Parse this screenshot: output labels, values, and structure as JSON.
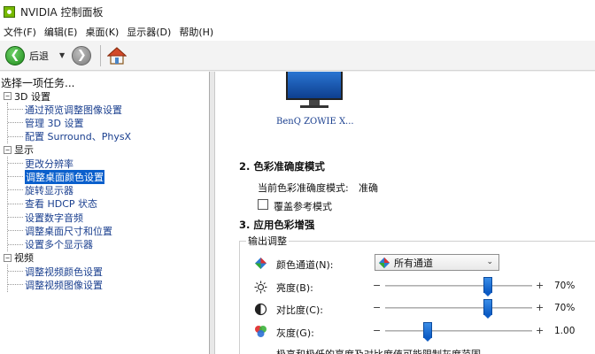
{
  "window": {
    "title": "NVIDIA 控制面板"
  },
  "menu": [
    "文件(F)",
    "编辑(E)",
    "桌面(K)",
    "显示器(D)",
    "帮助(H)"
  ],
  "toolbar": {
    "back_label": "后退"
  },
  "task_pane": {
    "header": "选择一项任务...",
    "categories": [
      {
        "label": "3D 设置",
        "toggle": "−",
        "items": [
          "通过预览调整图像设置",
          "管理 3D 设置",
          "配置 Surround、PhysX"
        ]
      },
      {
        "label": "显示",
        "toggle": "−",
        "items": [
          "更改分辨率",
          "调整桌面颜色设置",
          "旋转显示器",
          "查看 HDCP 状态",
          "设置数字音频",
          "调整桌面尺寸和位置",
          "设置多个显示器"
        ]
      },
      {
        "label": "视频",
        "toggle": "−",
        "items": [
          "调整视频颜色设置",
          "调整视频图像设置"
        ]
      }
    ],
    "selected_item": "调整桌面颜色设置"
  },
  "content": {
    "monitor_label": "BenQ ZOWIE X...",
    "section2": {
      "title": "2. 色彩准确度模式",
      "current_mode_label": "当前色彩准确度模式:",
      "current_mode_value": "准确",
      "override_label": "覆盖参考模式"
    },
    "section3": {
      "title": "3. 应用色彩增强",
      "group_title": "输出调整",
      "channel": {
        "label": "颜色通道(N):",
        "value": "所有通道"
      },
      "sliders": [
        {
          "label": "亮度(B):",
          "value_text": "70%",
          "fraction": 0.7
        },
        {
          "label": "对比度(C):",
          "value_text": "70%",
          "fraction": 0.7
        },
        {
          "label": "灰度(G):",
          "value_text": "1.00",
          "fraction": 0.29
        }
      ],
      "minus_sign": "−",
      "plus_sign": "+",
      "footer_text": "极高和极低的亮度及对比度值可能限制灰度范围。"
    }
  },
  "colors": {
    "selection": "#0a5fcc",
    "link": "#1a3f8f",
    "slider_thumb": "#0c5bc4"
  }
}
